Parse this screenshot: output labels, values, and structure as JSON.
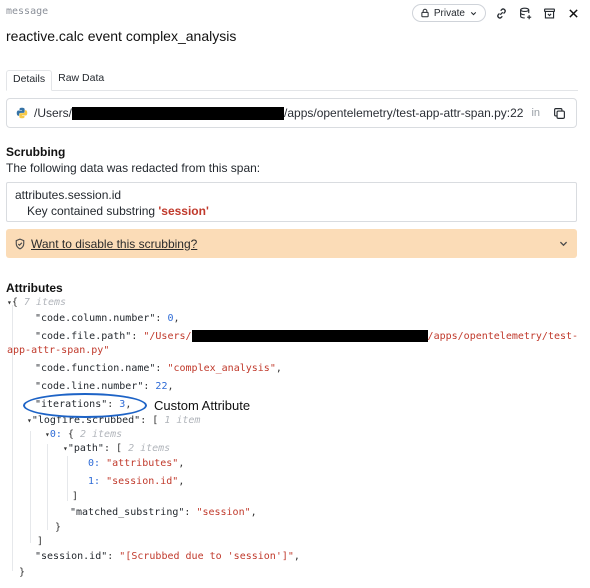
{
  "header": {
    "label": "message",
    "private_label": "Private",
    "icons": [
      "chevron-down-icon",
      "link-icon",
      "database-add-icon",
      "archive-icon",
      "close-icon"
    ]
  },
  "title": "reactive.calc event complex_analysis",
  "tabs": [
    {
      "label": "Details",
      "active": true
    },
    {
      "label": "Raw Data",
      "active": false
    }
  ],
  "file": {
    "prefix": "/Users/",
    "suffix": "/apps/opentelemetry/test-app-attr-span.py:22",
    "in_label": "in"
  },
  "scrubbing": {
    "title": "Scrubbing",
    "description": "The following data was redacted from this span:",
    "key": "attributes.session.id",
    "reason_prefix": "Key contained substring ",
    "reason_value": "'session'",
    "warning_link": "Want to disable this scrubbing?"
  },
  "attributes": {
    "title": "Attributes",
    "root_open": "{",
    "root_count": "7 items",
    "column_key": "\"code.column.number\"",
    "column_value": "0",
    "filepath_key": "\"code.file.path\"",
    "filepath_prefix": "\"/Users/",
    "filepath_suffix": "/apps/opentelemetry/test-",
    "filepath_cont": "app-attr-span.py\"",
    "function_key": "\"code.function.name\"",
    "function_value": "\"complex_analysis\"",
    "line_key": "\"code.line.number\"",
    "line_value": "22",
    "iterations_key": "\"iterations\"",
    "iterations_value": "3",
    "scrubbed_key": "\"logfire.scrubbed\"",
    "scrubbed_open": "[",
    "scrubbed_count": "1 item",
    "item0_key": "0:",
    "item0_open": "{",
    "item0_count": "2 items",
    "path_key": "\"path\"",
    "path_open": "[",
    "path_count": "2 items",
    "path0_index": "0:",
    "path0_value": "\"attributes\"",
    "path1_index": "1:",
    "path1_value": "\"session.id\"",
    "path_close": "]",
    "matched_key": "\"matched_substring\"",
    "matched_value": "\"session\"",
    "item0_close": "}",
    "scrubbed_close": "]",
    "session_key": "\"session.id\"",
    "session_value": "\"[Scrubbed due to 'session']\"",
    "root_close": "}"
  },
  "annotation": {
    "label": "Custom Attribute",
    "color": "#1d63c6"
  }
}
